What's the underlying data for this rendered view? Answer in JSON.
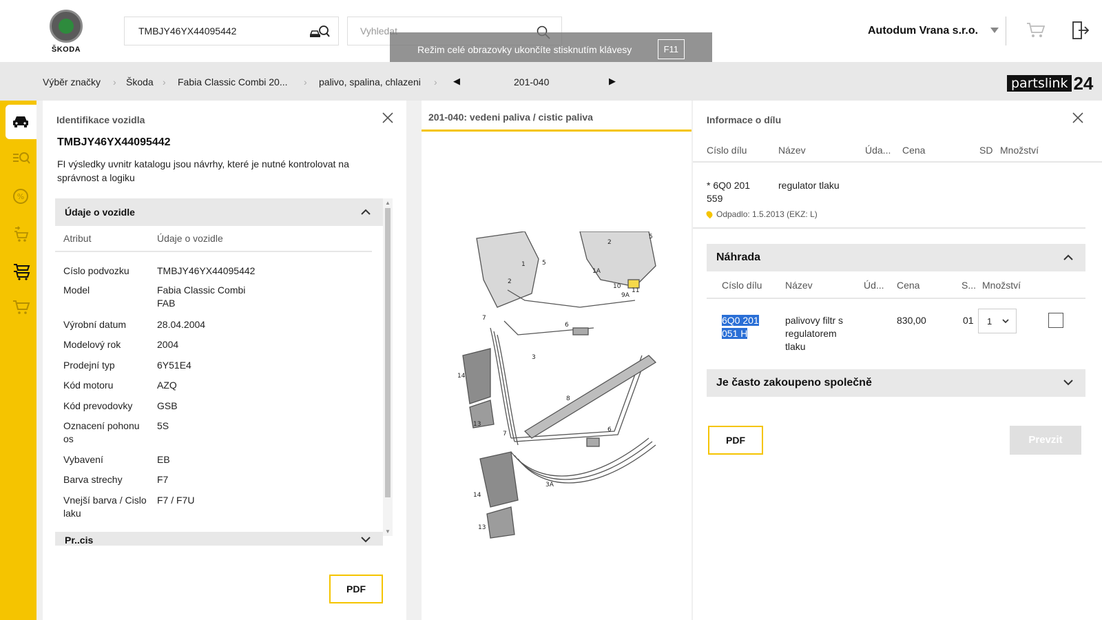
{
  "header": {
    "logo_text": "ŠKODA",
    "vin_value": "TMBJY46YX44095442",
    "search_placeholder": "Vyhledat",
    "fullscreen_msg": "Režim celé obrazovky ukončíte stisknutím klávesy",
    "fullscreen_key": "F11",
    "company": "Autodum Vrana s.r.o."
  },
  "breadcrumb": {
    "items": [
      "Výběr značky",
      "Škoda",
      "Fabia Classic Combi 20...",
      "palivo, spalina, chlazeni"
    ],
    "page": "201-040",
    "brand_a": "partslink",
    "brand_b": "24"
  },
  "rail": [
    "car-icon",
    "search-list-icon",
    "percent-icon",
    "swap-cart-icon",
    "cart-stack-icon",
    "cart-icon"
  ],
  "left_panel": {
    "title": "Identifikace vozidla",
    "vin": "TMBJY46YX44095442",
    "note": "FI výsledky uvnitr katalogu jsou návrhy, které je nutné kontrolovat na správnost a logiku",
    "section_title": "Údaje o vozidle",
    "col_attr": "Atribut",
    "col_value": "Údaje o vozidle",
    "rows": [
      {
        "k": "Císlo podvozku",
        "v": "TMBJY46YX44095442"
      },
      {
        "k": "Model",
        "v": "Fabia Classic Combi FAB"
      },
      {
        "k": "Výrobní datum",
        "v": "28.04.2004"
      },
      {
        "k": "Modelový rok",
        "v": "2004"
      },
      {
        "k": "Prodejní typ",
        "v": "6Y51E4"
      },
      {
        "k": "Kód motoru",
        "v": "AZQ"
      },
      {
        "k": "Kód prevodovky",
        "v": "GSB"
      },
      {
        "k": "Oznacení pohonu os",
        "v": "5S"
      },
      {
        "k": "Vybavení",
        "v": "EB"
      },
      {
        "k": "Barva strechy",
        "v": "F7"
      },
      {
        "k": "Vnejší barva / Cislo laku",
        "v": "F7 / F7U"
      }
    ],
    "next_section": "Pr..cis",
    "pdf": "PDF"
  },
  "mid_panel": {
    "title": "201-040: vedeni paliva / cistic paliva"
  },
  "right_panel": {
    "title": "Informace o dílu",
    "cols": [
      "Císlo dílu",
      "Název",
      "Úda...",
      "Cena",
      "SD",
      "Množství"
    ],
    "part_number": "* 6Q0 201 559",
    "part_name": "regulator tlaku",
    "odpadlo": "Odpadlo: 1.5.2013 (EKZ: L)",
    "replacement_title": "Náhrada",
    "rep_cols": [
      "Císlo dílu",
      "Název",
      "Úd...",
      "Cena",
      "S...",
      "Množství"
    ],
    "rep_part_number": "6Q0 201 051 H",
    "rep_part_name": "palivovy filtr s regulatorem tlaku",
    "rep_price": "830,00",
    "rep_sd": "01",
    "rep_qty": "1",
    "often_bought": "Je často zakoupeno společně",
    "pdf": "PDF",
    "prevzit": "Prevzit"
  },
  "colors": {
    "accent": "#f5c400",
    "selection": "#2a6fd6"
  }
}
